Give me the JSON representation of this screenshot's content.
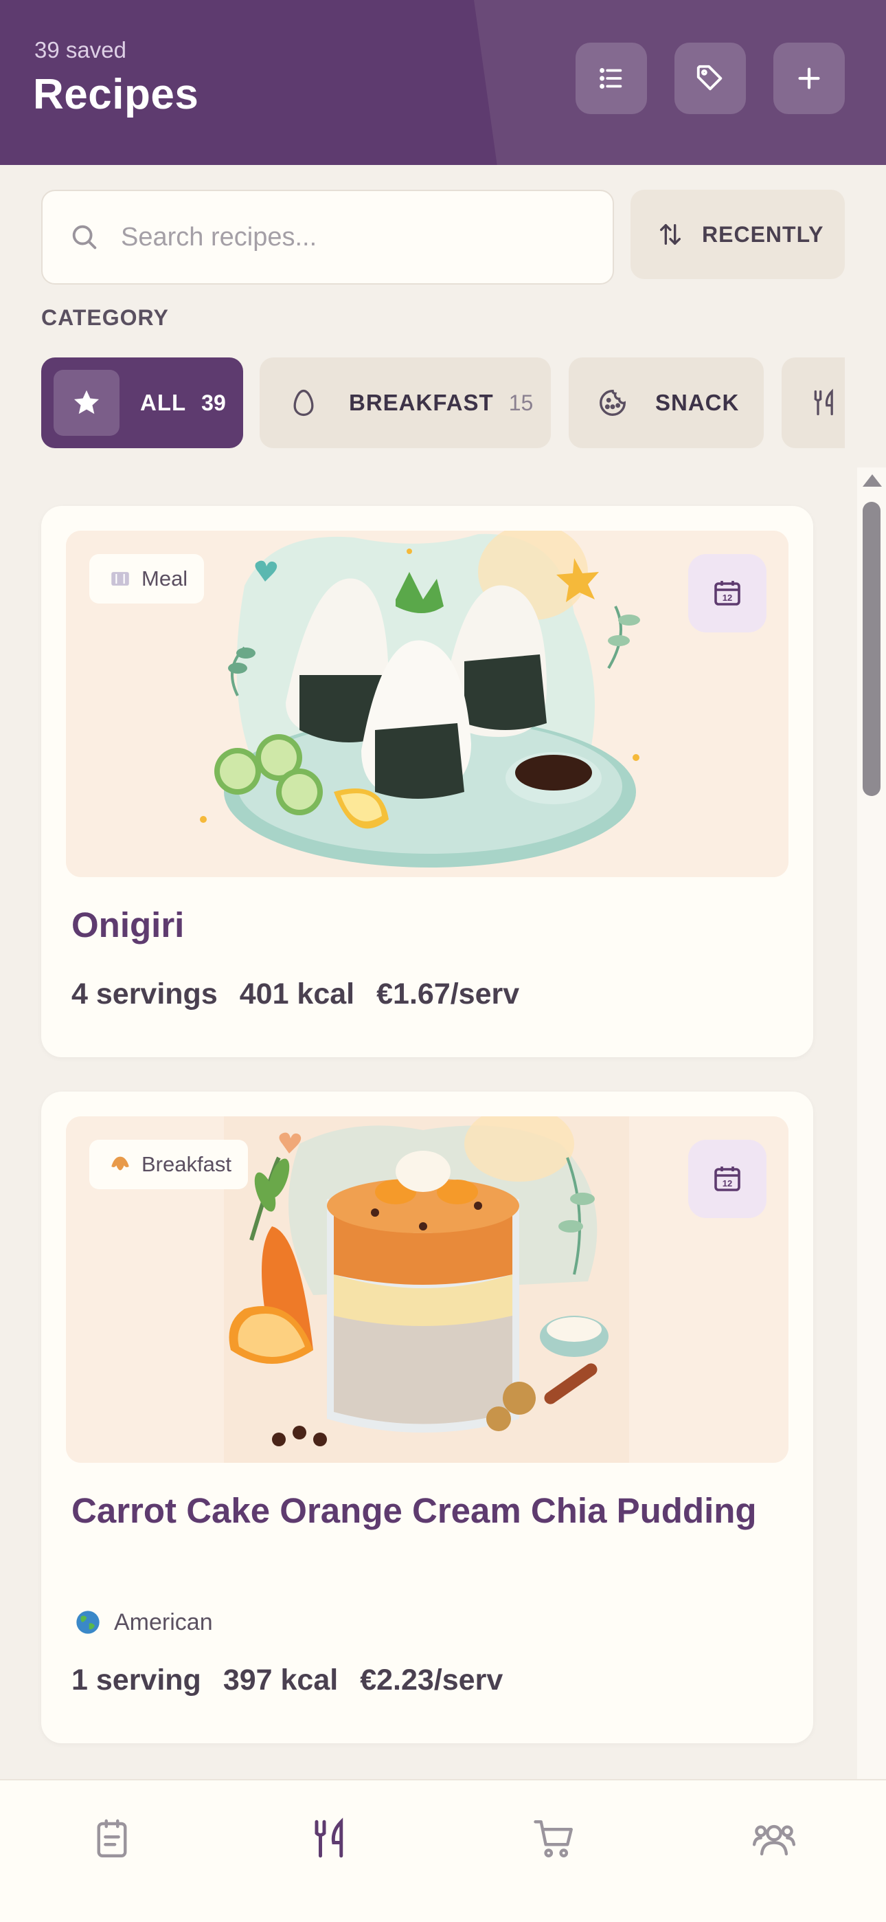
{
  "header": {
    "saved_text": "39 saved",
    "title": "Recipes",
    "actions": [
      {
        "icon": "list-icon"
      },
      {
        "icon": "tag-icon"
      },
      {
        "icon": "plus-icon"
      }
    ]
  },
  "search": {
    "placeholder": "Search recipes...",
    "value": ""
  },
  "sort": {
    "label": "RECENTLY",
    "icon": "sort-arrows-icon"
  },
  "category_label": "CATEGORY",
  "categories": [
    {
      "label": "ALL",
      "count": "39",
      "icon": "star-icon",
      "active": true
    },
    {
      "label": "BREAKFAST",
      "count": "15",
      "icon": "egg-icon",
      "active": false
    },
    {
      "label": "SNACK",
      "count": "",
      "icon": "cookie-icon",
      "active": false
    },
    {
      "label": "",
      "count": "",
      "icon": "utensils-icon",
      "active": false
    }
  ],
  "recipes": [
    {
      "tag": "Meal",
      "tag_icon": "plate-icon",
      "title": "Onigiri",
      "cuisine": "",
      "servings": "4 servings",
      "kcal": "401 kcal",
      "cost": "€1.67/serv",
      "calendar_day": "12"
    },
    {
      "tag": "Breakfast",
      "tag_icon": "croissant-icon",
      "title": "Carrot Cake Orange Cream Chia Pudding",
      "cuisine": "American",
      "cuisine_icon": "globe-icon",
      "servings": "1 serving",
      "kcal": "397 kcal",
      "cost": "€2.23/serv",
      "calendar_day": "12"
    }
  ],
  "bottom_nav": [
    {
      "icon": "notepad-icon",
      "active": false
    },
    {
      "icon": "utensils-icon",
      "active": true
    },
    {
      "icon": "cart-icon",
      "active": false
    },
    {
      "icon": "users-icon",
      "active": false
    }
  ],
  "colors": {
    "primary": "#5e3b6f",
    "background": "#f4f0ea",
    "card": "#fffdf7",
    "chip_idle": "#ebe4da"
  }
}
